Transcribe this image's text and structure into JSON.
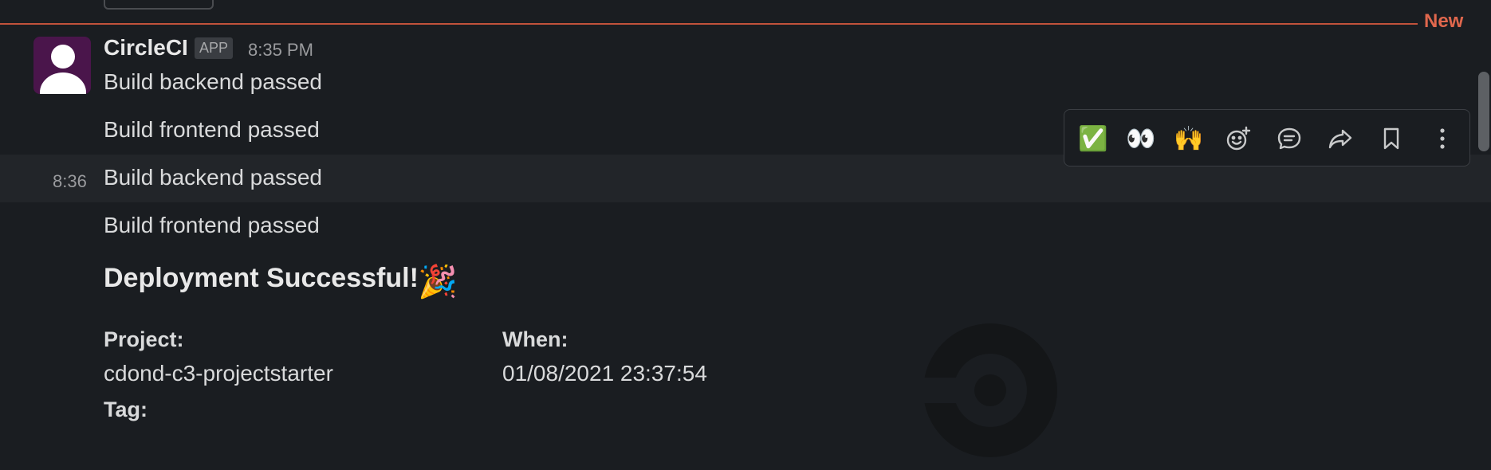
{
  "divider": {
    "label": "New"
  },
  "message": {
    "sender": "CircleCI",
    "badge": "APP",
    "time": "8:35 PM",
    "lines": [
      "Build backend passed",
      "Build frontend passed"
    ],
    "hover_time": "8:36",
    "hover_lines": [
      "Build backend passed",
      "Build frontend passed"
    ]
  },
  "toolbar": {
    "reactions": [
      {
        "name": "white-check-mark",
        "glyph": "✅"
      },
      {
        "name": "eyes",
        "glyph": "👀"
      },
      {
        "name": "raised-hands",
        "glyph": "🙌"
      }
    ],
    "icons": [
      "add-reaction-icon",
      "reply-in-thread-icon",
      "share-icon",
      "bookmark-icon",
      "more-actions-icon"
    ]
  },
  "attachment": {
    "heading": "Deployment Successful!",
    "heading_emoji": "🎉",
    "fields": [
      {
        "label": "Project",
        "value": "cdond-c3-projectstarter"
      },
      {
        "label": "When",
        "value": "01/08/2021 23:37:54"
      },
      {
        "label": "Tag",
        "value": ""
      }
    ]
  },
  "colors": {
    "background": "#1a1d21",
    "new_divider": "#e0674d",
    "avatar_bg": "#4a154b"
  }
}
